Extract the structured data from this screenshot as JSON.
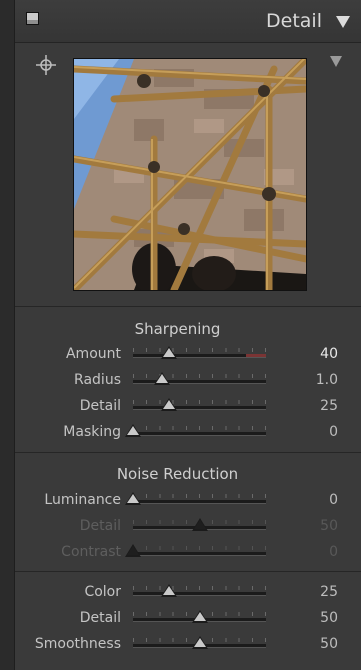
{
  "header": {
    "title": "Detail"
  },
  "sharpening": {
    "title": "Sharpening",
    "rows": [
      {
        "label": "Amount",
        "value": "40",
        "pos": 0.27,
        "highlight_end": 0.85
      },
      {
        "label": "Radius",
        "value": "1.0",
        "pos": 0.22
      },
      {
        "label": "Detail",
        "value": "25",
        "pos": 0.27
      },
      {
        "label": "Masking",
        "value": "0",
        "pos": 0.0
      }
    ]
  },
  "noise_reduction": {
    "title": "Noise Reduction",
    "rows": [
      {
        "label": "Luminance",
        "value": "0",
        "pos": 0.0,
        "disabled": false
      },
      {
        "label": "Detail",
        "value": "50",
        "pos": 0.5,
        "disabled": true
      },
      {
        "label": "Contrast",
        "value": "0",
        "pos": 0.0,
        "disabled": true
      }
    ]
  },
  "color_noise": {
    "rows": [
      {
        "label": "Color",
        "value": "25",
        "pos": 0.27
      },
      {
        "label": "Detail",
        "value": "50",
        "pos": 0.5
      },
      {
        "label": "Smoothness",
        "value": "50",
        "pos": 0.5
      }
    ]
  },
  "colors": {
    "amount_fill": "#7a3434",
    "panel_bg": "#3a3a3a"
  }
}
